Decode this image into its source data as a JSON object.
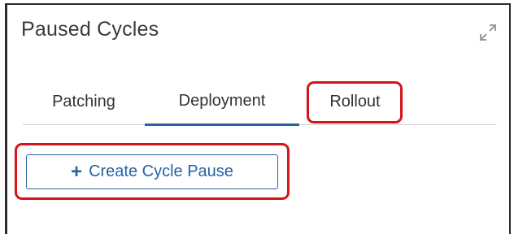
{
  "panel": {
    "title": "Paused Cycles"
  },
  "tabs": [
    {
      "label": "Patching",
      "active": false
    },
    {
      "label": "Deployment",
      "active": true
    },
    {
      "label": "Rollout",
      "active": false
    }
  ],
  "actions": {
    "create_label": "Create Cycle Pause",
    "create_icon": "plus-icon"
  },
  "colors": {
    "accent": "#2563a6",
    "highlight": "#d4141a",
    "text": "#333333"
  }
}
